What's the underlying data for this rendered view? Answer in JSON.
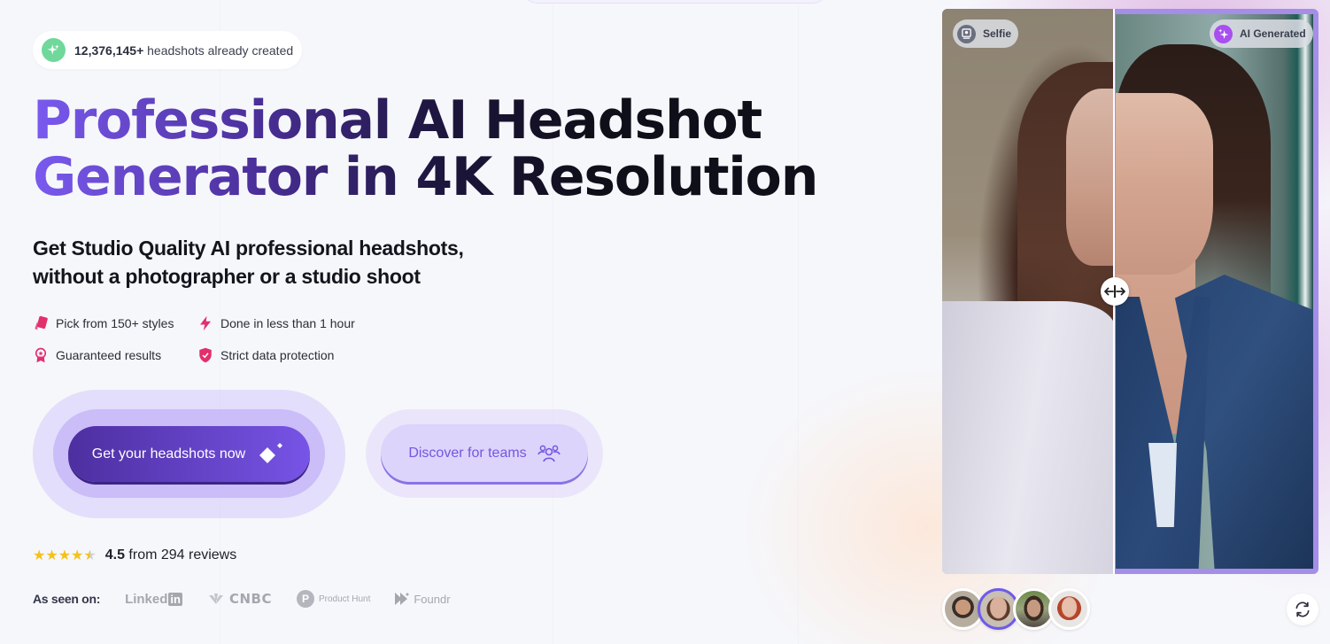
{
  "counter": {
    "number": "12,376,145+",
    "text": " headshots already created",
    "icon": "sparkle-icon"
  },
  "hero": {
    "title_line1": "Professional AI Headshot",
    "title_line2": "Generator in 4K Resolution",
    "subtitle_line1": "Get Studio Quality AI professional headshots,",
    "subtitle_line2": "without a photographer or a studio shoot"
  },
  "features": [
    {
      "label": "Pick from 150+ styles",
      "icon": "styles-cards-icon"
    },
    {
      "label": "Done in less than 1 hour",
      "icon": "lightning-icon"
    },
    {
      "label": "Guaranteed results",
      "icon": "award-badge-icon"
    },
    {
      "label": "Strict data protection",
      "icon": "shield-check-icon"
    }
  ],
  "buttons": {
    "primary": "Get your headshots now",
    "secondary": "Discover for teams"
  },
  "rating": {
    "value": "4.5",
    "stars": 4.5,
    "max_stars": 5,
    "text": " from 294 reviews"
  },
  "seen_on": {
    "label": "As seen on:",
    "logos": [
      "LinkedIn",
      "CNBC",
      "Product Hunt",
      "Foundr"
    ]
  },
  "comparison": {
    "left_label": "Selfie",
    "right_label": "AI Generated",
    "split_position": 0.46
  },
  "thumbnails": [
    {
      "name": "man-smiling",
      "active": false
    },
    {
      "name": "woman-brunette",
      "active": true
    },
    {
      "name": "man-bearded",
      "active": false
    },
    {
      "name": "woman-redhead",
      "active": false
    }
  ],
  "colors": {
    "accent": "#7754e6",
    "accent_dark": "#4d2fa0",
    "feature_icon": "#e1306c",
    "star": "#f5c11a",
    "counter_icon": "#6fd89a"
  }
}
